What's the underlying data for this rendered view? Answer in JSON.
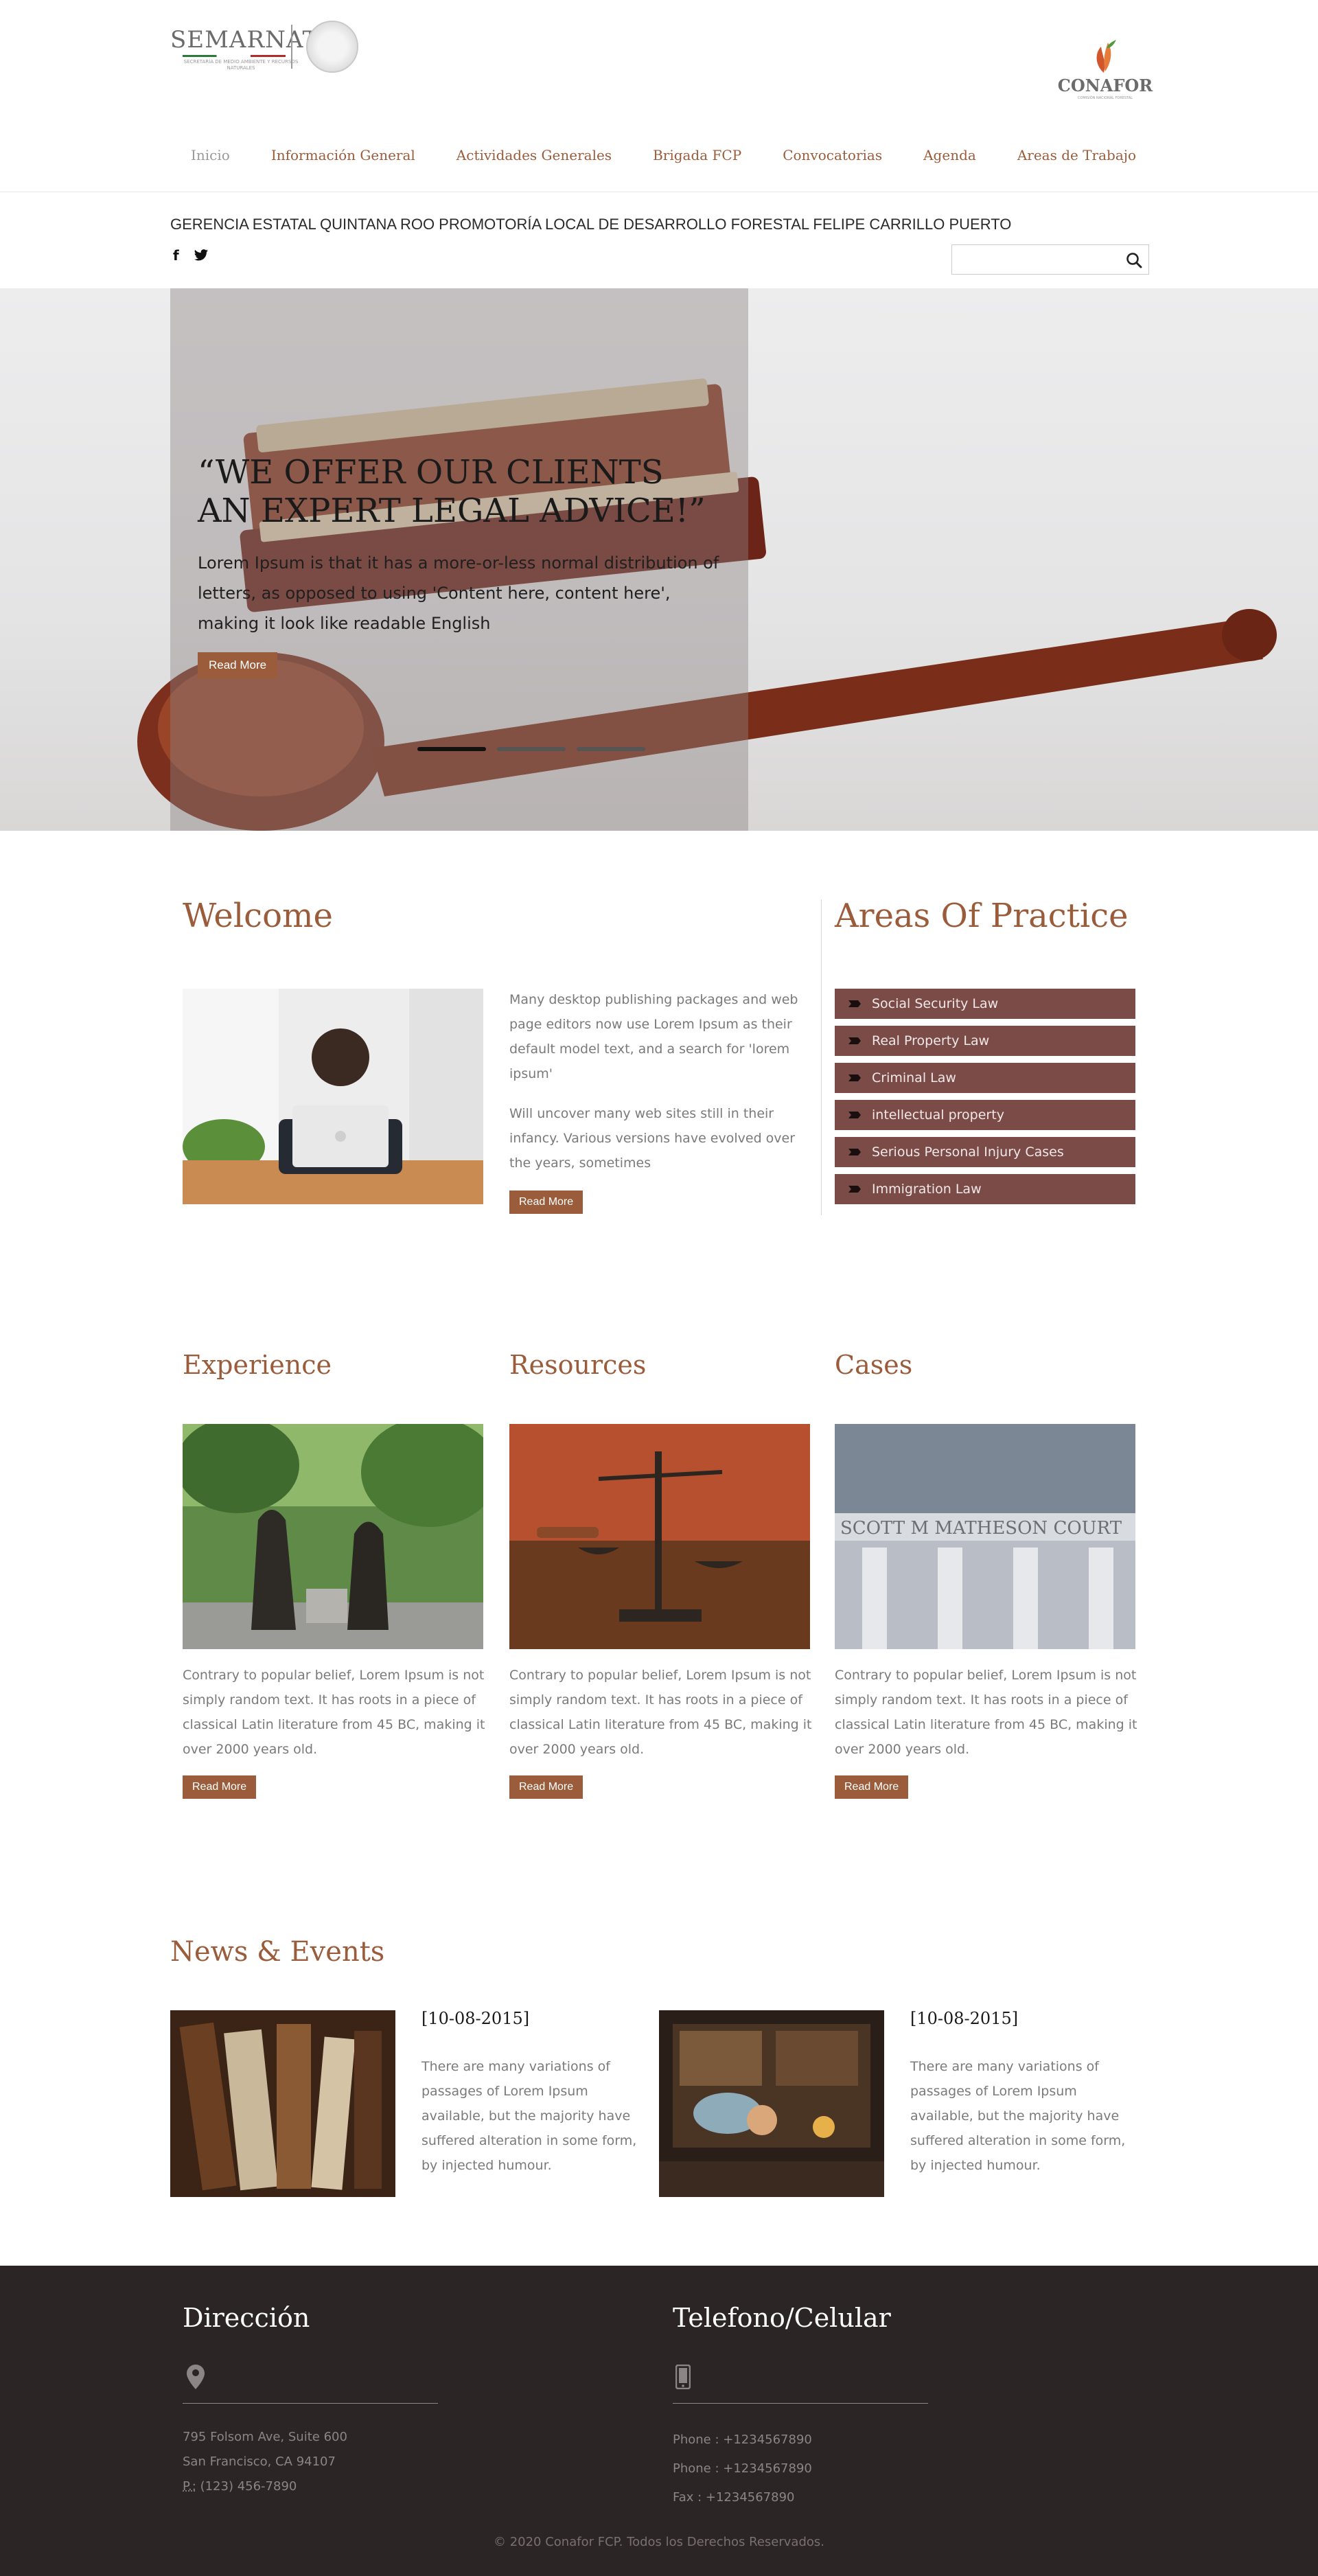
{
  "header": {
    "semarnat_logo_text": "SEMARNAT",
    "semarnat_sub": "SECRETARÍA DE MEDIO AMBIENTE Y RECURSOS NATURALES",
    "conafor_logo_text": "CONAFOR",
    "conafor_sub": "COMISIÓN NACIONAL FORESTAL"
  },
  "nav": {
    "items": [
      "Inicio",
      "Información General",
      "Actividades Generales",
      "Brigada FCP",
      "Convocatorias",
      "Agenda",
      "Areas de Trabajo"
    ]
  },
  "subheader": {
    "title": "GERENCIA ESTATAL QUINTANA ROO PROMOTORÍA LOCAL DE DESARROLLO FORESTAL FELIPE CARRILLO PUERTO",
    "social": {
      "facebook": "f",
      "twitter": "twitter-icon"
    },
    "search_value": ""
  },
  "hero": {
    "title": "“WE OFFER OUR CLIENTS AN EXPERT LEGAL ADVICE!”",
    "text": "Lorem Ipsum is that it has a more-or-less normal distribution of letters, as opposed to using 'Content here, content here', making it look like readable English",
    "button": "Read More",
    "slides_count": 3,
    "active_slide": 1
  },
  "welcome": {
    "title": "Welcome",
    "para1": "Many desktop publishing packages and web page editors now use Lorem Ipsum as their default model text, and a search for 'lorem ipsum'",
    "para2": "Will uncover many web sites still in their infancy. Various versions have evolved over the years, sometimes",
    "button": "Read More"
  },
  "practice": {
    "title": "Areas Of Practice",
    "items": [
      "Social Security Law",
      "Real Property Law",
      "Criminal Law",
      "intellectual property",
      "Serious Personal Injury Cases",
      "Immigration Law"
    ]
  },
  "columns": [
    {
      "title": "Experience",
      "text": "Contrary to popular belief, Lorem Ipsum is not simply random text. It has roots in a piece of classical Latin literature from 45 BC, making it over 2000 years old.",
      "button": "Read More"
    },
    {
      "title": "Resources",
      "text": "Contrary to popular belief, Lorem Ipsum is not simply random text. It has roots in a piece of classical Latin literature from 45 BC, making it over 2000 years old.",
      "button": "Read More"
    },
    {
      "title": "Cases",
      "text": "Contrary to popular belief, Lorem Ipsum is not simply random text. It has roots in a piece of classical Latin literature from 45 BC, making it over 2000 years old.",
      "button": "Read More"
    }
  ],
  "cases_building_text": "SCOTT M MATHESON COURT",
  "news": {
    "title": "News & Events",
    "items": [
      {
        "date": "[10-08-2015]",
        "text": "There are many variations of passages of Lorem Ipsum available, but the majority have suffered alteration in some form, by injected humour."
      },
      {
        "date": "[10-08-2015]",
        "text": "There are many variations of passages of Lorem Ipsum available, but the majority have suffered alteration in some form, by injected humour."
      }
    ]
  },
  "footer": {
    "address": {
      "title": "Dirección",
      "line1": "795 Folsom Ave, Suite 600",
      "line2": "San Francisco, CA 94107",
      "phone_label": "P.:",
      "phone": "(123) 456-7890"
    },
    "contact": {
      "title": "Telefono/Celular",
      "phone1": "Phone : +1234567890",
      "phone2": "Phone : +1234567890",
      "fax": "Fax : +1234567890"
    },
    "copyright": "© 2020 Conafor FCP. Todos los Derechos Reservados."
  },
  "colors": {
    "accent": "#9a5c3b",
    "practice_bg": "#7a4b47",
    "footer_bg": "#2b2526"
  }
}
